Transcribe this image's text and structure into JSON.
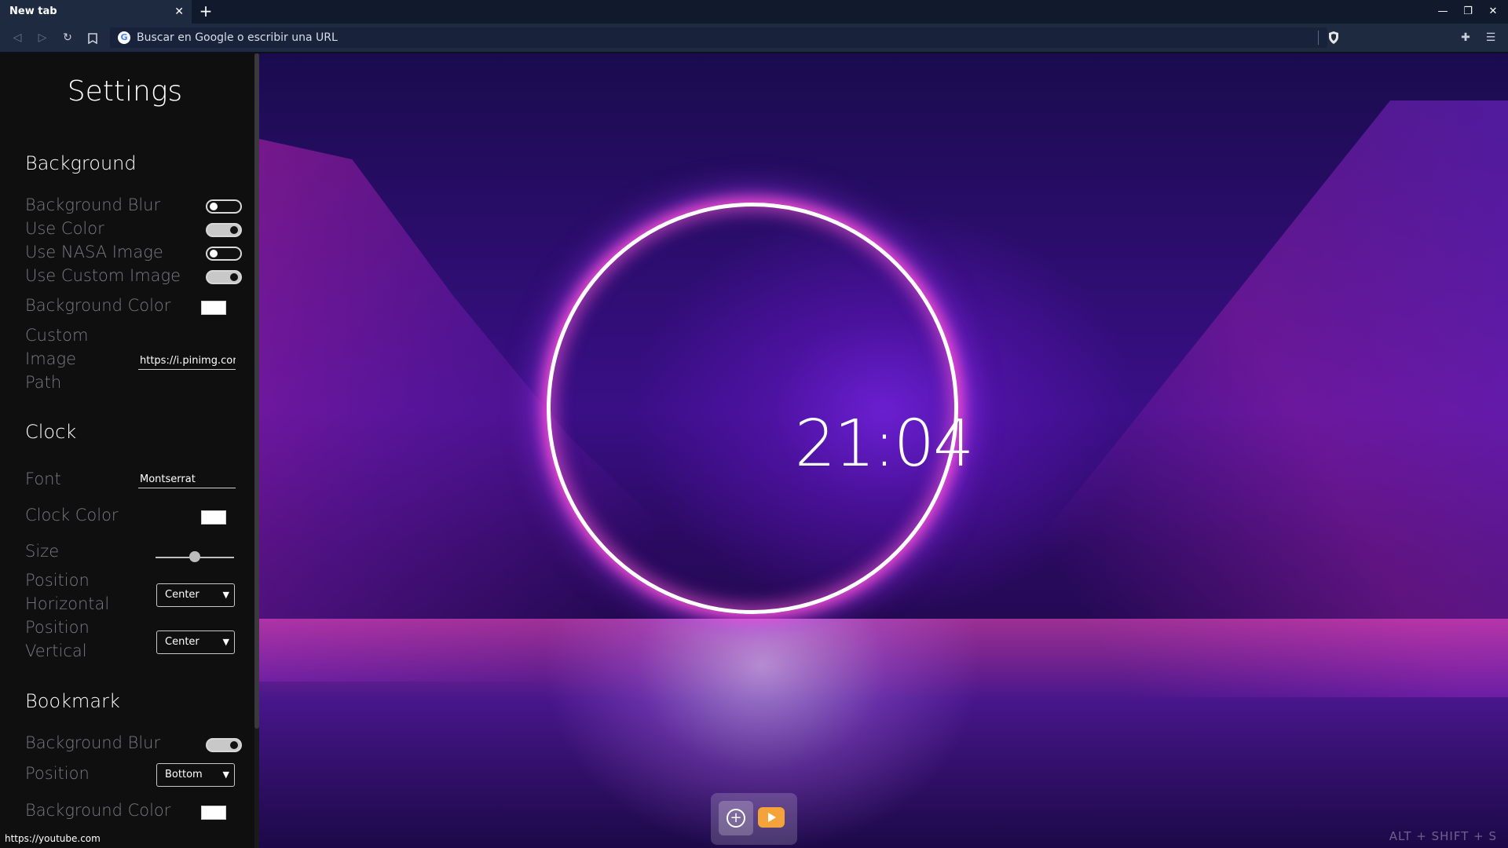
{
  "browser": {
    "tab_title": "New tab",
    "tab_close": "✕",
    "new_tab": "+",
    "omnibox_placeholder": "Buscar en Google o escribir una URL",
    "window_controls": {
      "minimize": "—",
      "restore": "❐",
      "close": "✕"
    },
    "status_url": "https://youtube.com"
  },
  "settings": {
    "title": "Settings",
    "background": {
      "heading": "Background",
      "blur_label": "Background Blur",
      "blur_on": false,
      "use_color_label": "Use Color",
      "use_color_on": true,
      "nasa_label": "Use NASA Image",
      "nasa_on": false,
      "custom_label": "Use Custom Image",
      "custom_on": true,
      "color_label": "Background Color",
      "color_value": "#ffffff",
      "path_label_1": "Custom",
      "path_label_2": "Image",
      "path_label_3": "Path",
      "path_value": "https://i.pinimg.com/"
    },
    "clock": {
      "heading": "Clock",
      "font_label": "Font",
      "font_value": "Montserrat",
      "color_label": "Clock Color",
      "color_value": "#ffffff",
      "size_label": "Size",
      "size_level": 0.5,
      "pos_h_label_1": "Position",
      "pos_h_label_2": "Horizontal",
      "pos_h_value": "Center",
      "pos_v_label_1": "Position",
      "pos_v_label_2": "Vertical",
      "pos_v_value": "Center"
    },
    "bookmark": {
      "heading": "Bookmark",
      "blur_label": "Background Blur",
      "blur_on": true,
      "position_label": "Position",
      "position_value": "Bottom",
      "color_label": "Background Color",
      "color_value": "#ffffff"
    }
  },
  "main": {
    "clock_time": "21:04",
    "shortcut_hint": "ALT + SHIFT + S"
  },
  "icons": [
    "back-icon",
    "forward-icon",
    "reload-icon",
    "bookmark-icon",
    "google-icon",
    "brave-shield-icon",
    "extensions-icon",
    "menu-icon",
    "add-bookmark-icon",
    "youtube-icon"
  ]
}
